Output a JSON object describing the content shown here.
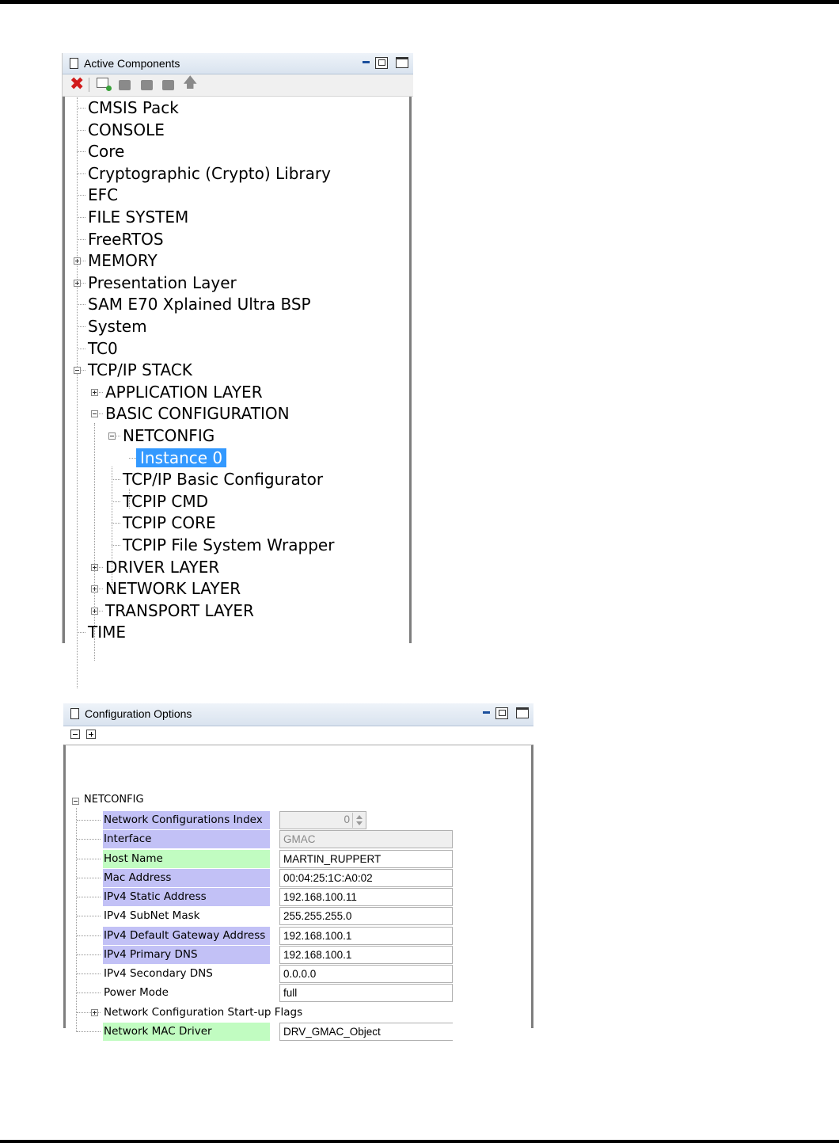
{
  "active_components": {
    "title": "Active Components",
    "toolbar": {
      "delete_icon": "delete-icon",
      "add_icon": "add-component-icon",
      "icons": [
        "component-icon",
        "component-icon",
        "component-icon",
        "up-arrow-icon"
      ]
    },
    "tree": [
      {
        "label": "CMSIS Pack",
        "level": 0,
        "expander": "none"
      },
      {
        "label": "CONSOLE",
        "level": 0,
        "expander": "none"
      },
      {
        "label": "Core",
        "level": 0,
        "expander": "none"
      },
      {
        "label": "Cryptographic (Crypto) Library",
        "level": 0,
        "expander": "none"
      },
      {
        "label": "EFC",
        "level": 0,
        "expander": "none"
      },
      {
        "label": "FILE SYSTEM",
        "level": 0,
        "expander": "none"
      },
      {
        "label": "FreeRTOS",
        "level": 0,
        "expander": "none"
      },
      {
        "label": "MEMORY",
        "level": 0,
        "expander": "collapsed"
      },
      {
        "label": "Presentation Layer",
        "level": 0,
        "expander": "collapsed"
      },
      {
        "label": "SAM E70 Xplained Ultra BSP",
        "level": 0,
        "expander": "none"
      },
      {
        "label": "System",
        "level": 0,
        "expander": "none"
      },
      {
        "label": "TC0",
        "level": 0,
        "expander": "none"
      },
      {
        "label": "TCP/IP STACK",
        "level": 0,
        "expander": "expanded"
      },
      {
        "label": "APPLICATION LAYER",
        "level": 1,
        "expander": "collapsed"
      },
      {
        "label": "BASIC CONFIGURATION",
        "level": 1,
        "expander": "expanded"
      },
      {
        "label": "NETCONFIG",
        "level": 2,
        "expander": "expanded"
      },
      {
        "label": "Instance 0",
        "level": 3,
        "expander": "none",
        "selected": true
      },
      {
        "label": "TCP/IP Basic Configurator",
        "level": 2,
        "expander": "none"
      },
      {
        "label": "TCPIP CMD",
        "level": 2,
        "expander": "none"
      },
      {
        "label": "TCPIP CORE",
        "level": 2,
        "expander": "none"
      },
      {
        "label": "TCPIP File System Wrapper",
        "level": 2,
        "expander": "none"
      },
      {
        "label": "DRIVER LAYER",
        "level": 1,
        "expander": "collapsed"
      },
      {
        "label": "NETWORK LAYER",
        "level": 1,
        "expander": "collapsed"
      },
      {
        "label": "TRANSPORT LAYER",
        "level": 1,
        "expander": "collapsed"
      },
      {
        "label": "TIME",
        "level": 0,
        "expander": "none"
      }
    ]
  },
  "configuration_options": {
    "title": "Configuration Options",
    "root": "NETCONFIG",
    "highlight_colors": {
      "purple": "#c2c1f6",
      "green": "#c1fcc1",
      "selection": "#3399ff"
    },
    "rows": [
      {
        "label": "Network Configurations Index",
        "value": "0",
        "kind": "spinner",
        "highlight": "purple"
      },
      {
        "label": "Interface",
        "value": "GMAC",
        "kind": "disabled",
        "highlight": "purple"
      },
      {
        "label": "Host Name",
        "value": "MARTIN_RUPPERT",
        "kind": "text",
        "highlight": "green"
      },
      {
        "label": "Mac Address",
        "value": "00:04:25:1C:A0:02",
        "kind": "text",
        "highlight": "purple"
      },
      {
        "label": "IPv4 Static Address",
        "value": "192.168.100.11",
        "kind": "text",
        "highlight": "purple"
      },
      {
        "label": "IPv4 SubNet Mask",
        "value": "255.255.255.0",
        "kind": "text",
        "highlight": "none"
      },
      {
        "label": "IPv4 Default Gateway Address",
        "value": "192.168.100.1",
        "kind": "text",
        "highlight": "purple"
      },
      {
        "label": "IPv4 Primary DNS",
        "value": "192.168.100.1",
        "kind": "text",
        "highlight": "purple"
      },
      {
        "label": "IPv4 Secondary DNS",
        "value": "0.0.0.0",
        "kind": "text",
        "highlight": "none"
      },
      {
        "label": "Power Mode",
        "value": "full",
        "kind": "text",
        "highlight": "none"
      },
      {
        "label": "Network Configuration Start-up Flags",
        "value": "",
        "kind": "group",
        "highlight": "none"
      },
      {
        "label": "Network MAC Driver",
        "value": "DRV_GMAC_Object",
        "kind": "text-open",
        "highlight": "green"
      }
    ]
  }
}
